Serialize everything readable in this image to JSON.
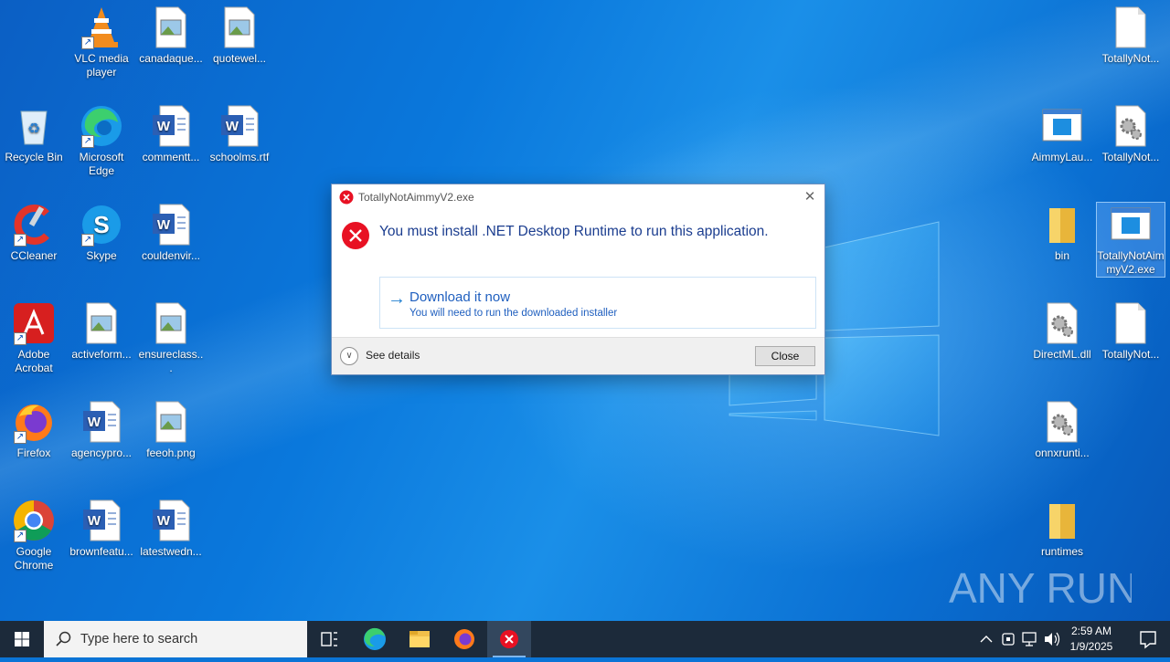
{
  "desktop": {
    "icons": [
      {
        "label": "VLC media player"
      },
      {
        "label": "canadaque..."
      },
      {
        "label": "quotewel..."
      },
      {
        "label": "Recycle Bin"
      },
      {
        "label": "Microsoft Edge"
      },
      {
        "label": "commentt..."
      },
      {
        "label": "schoolms.rtf"
      },
      {
        "label": "CCleaner"
      },
      {
        "label": "Skype"
      },
      {
        "label": "couldenvir..."
      },
      {
        "label": "Adobe Acrobat"
      },
      {
        "label": "activeform..."
      },
      {
        "label": "ensureclass..."
      },
      {
        "label": "Firefox"
      },
      {
        "label": "agencypro..."
      },
      {
        "label": "feeoh.png"
      },
      {
        "label": "Google Chrome"
      },
      {
        "label": "brownfeatu..."
      },
      {
        "label": "latestwedn..."
      },
      {
        "label": "TotallyNot..."
      },
      {
        "label": "AimmyLau..."
      },
      {
        "label": "TotallyNot..."
      },
      {
        "label": "bin"
      },
      {
        "label": "TotallyNotAimmyV2.exe"
      },
      {
        "label": "DirectML.dll"
      },
      {
        "label": "TotallyNot..."
      },
      {
        "label": "onnxrunti..."
      },
      {
        "label": "runtimes"
      }
    ]
  },
  "dialog": {
    "title": "TotallyNotAimmyV2.exe",
    "message": "You must install .NET Desktop Runtime to run this application.",
    "download_main": "Download it now",
    "download_sub": "You will need to run the downloaded installer",
    "see_details": "See details",
    "close_button": "Close"
  },
  "taskbar": {
    "search_placeholder": "Type here to search",
    "time": "2:59 AM",
    "date": "1/9/2025"
  },
  "watermark": {
    "text": "ANY RUN"
  },
  "colors": {
    "desktop_blue": "#0a74d6",
    "taskbar": "#1c2a3a",
    "error_red": "#e81123",
    "link_blue": "#1f5fbf"
  }
}
